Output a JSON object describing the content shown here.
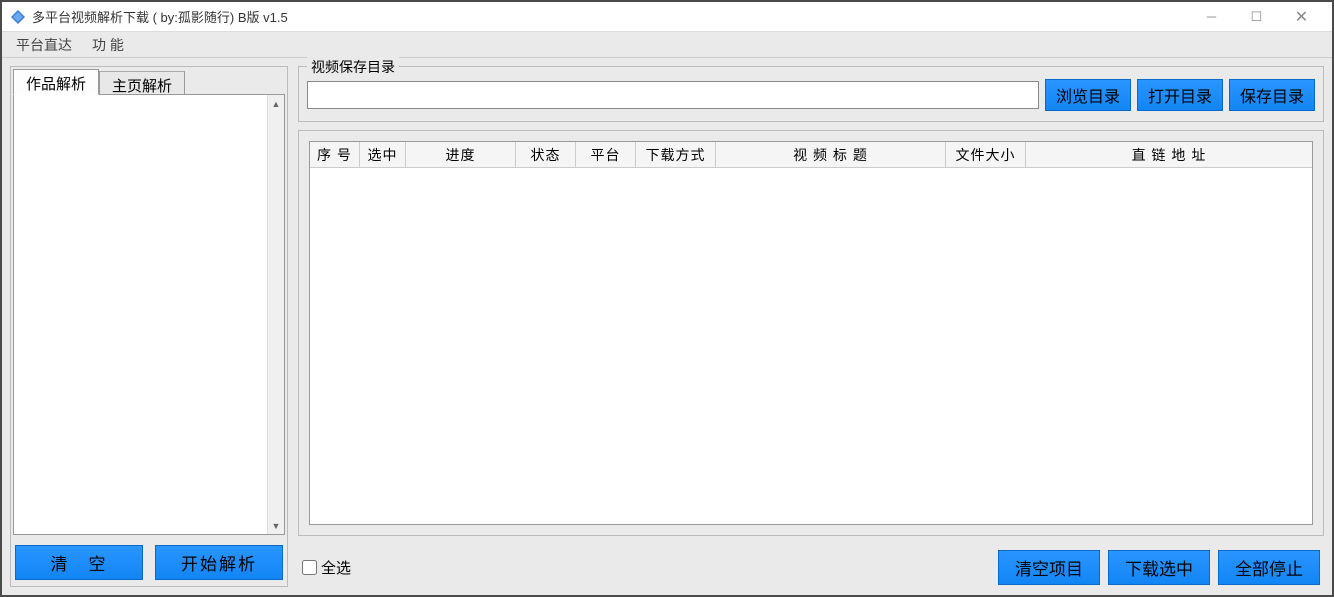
{
  "titlebar": {
    "title": "多平台视频解析下载 ( by:孤影随行) B版 v1.5"
  },
  "menubar": {
    "platform": "平台直达",
    "function": "功 能"
  },
  "leftPanel": {
    "tabs": {
      "work": "作品解析",
      "home": "主页解析"
    },
    "textarea_value": "",
    "buttons": {
      "clear": "清　空",
      "start": "开始解析"
    }
  },
  "rightPanel": {
    "dirGroup": {
      "label": "视频保存目录",
      "input_value": "",
      "browse": "浏览目录",
      "open": "打开目录",
      "save": "保存目录"
    },
    "table": {
      "columns": {
        "seq": "序 号",
        "select": "选中",
        "progress": "进度",
        "status": "状态",
        "platform": "平台",
        "download_mode": "下载方式",
        "title": "视 频 标 题",
        "filesize": "文件大小",
        "url": "直 链 地 址"
      }
    },
    "bottom": {
      "select_all": "全选",
      "clear_items": "清空项目",
      "download_selected": "下载选中",
      "stop_all": "全部停止"
    }
  }
}
